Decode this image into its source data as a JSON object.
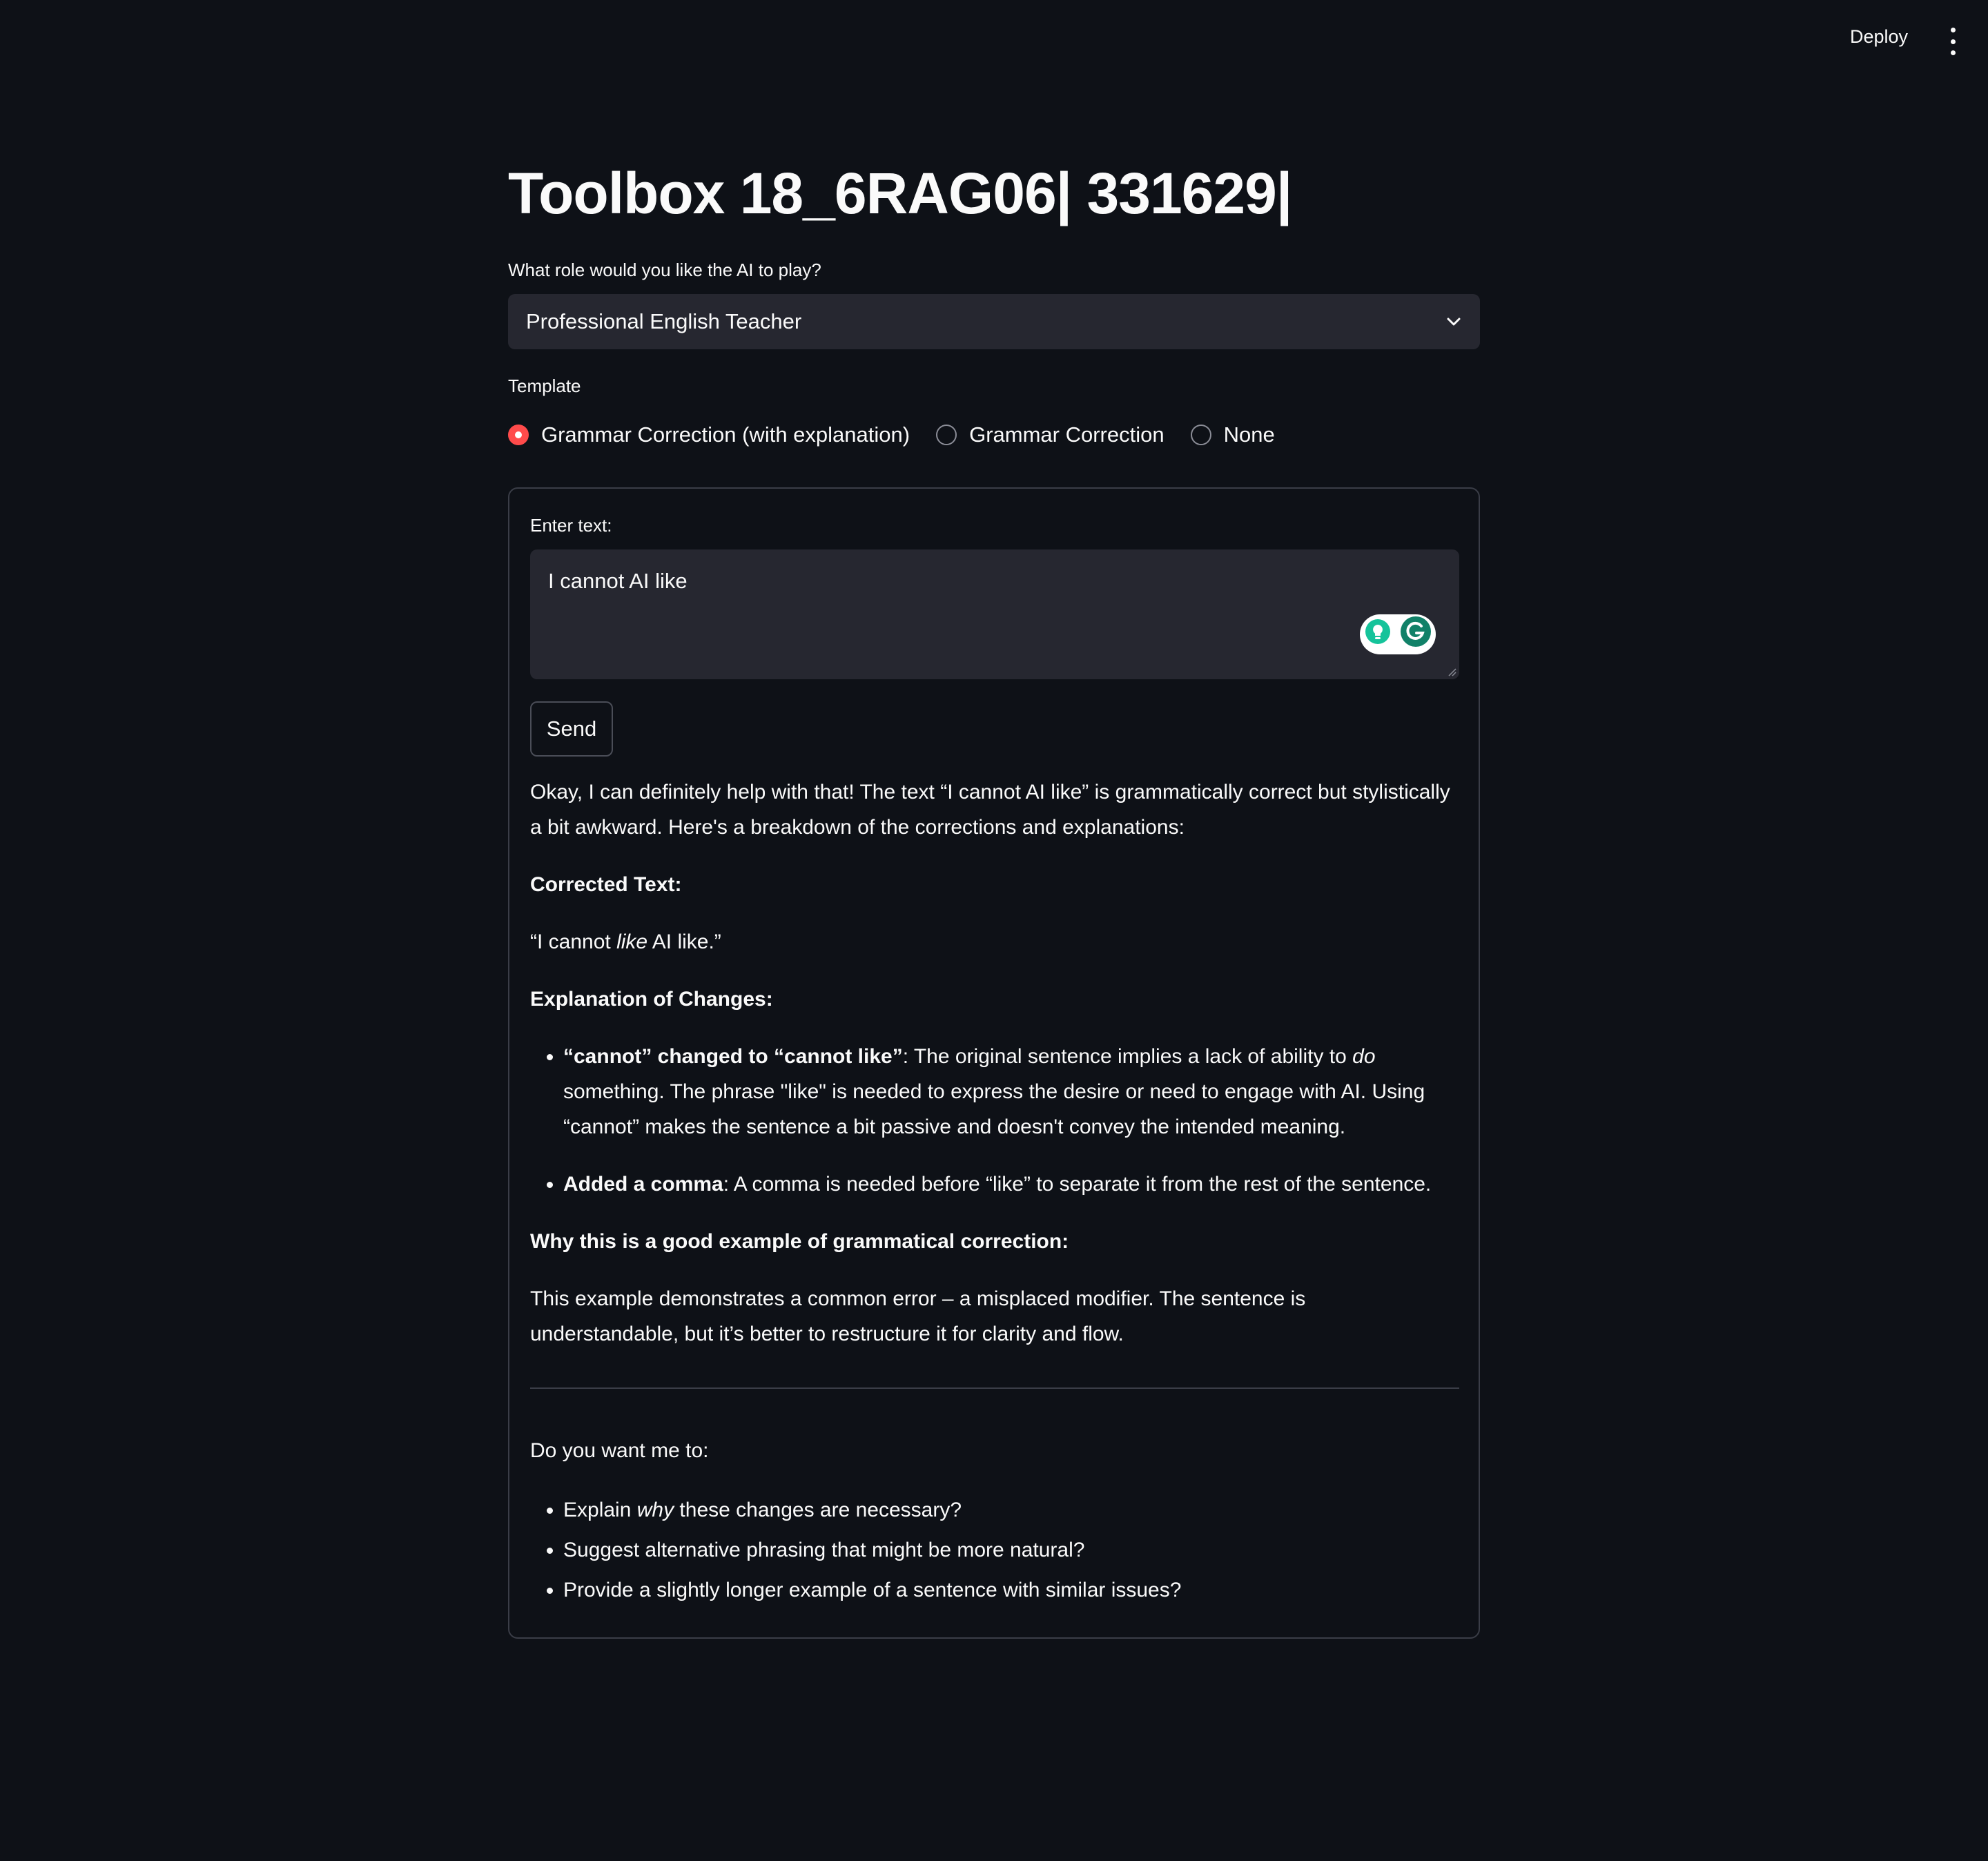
{
  "header": {
    "deploy_label": "Deploy",
    "menu_icon": "more-vertical-icon"
  },
  "page": {
    "title": "Toolbox 18_6RAG06| 331629|"
  },
  "role_select": {
    "label": "What role would you like the AI to play?",
    "value": "Professional English Teacher",
    "icon": "chevron-down-icon"
  },
  "template": {
    "label": "Template",
    "options": [
      {
        "label": "Grammar Correction (with explanation)",
        "checked": true
      },
      {
        "label": "Grammar Correction",
        "checked": false
      },
      {
        "label": "None",
        "checked": false
      }
    ]
  },
  "input": {
    "label": "Enter text:",
    "value": "I cannot AI like"
  },
  "send_label": "Send",
  "response": {
    "intro": "Okay, I can definitely help with that! The text “I cannot AI like” is grammatically correct but stylistically a bit awkward. Here's a breakdown of the corrections and explanations:",
    "corrected_heading": "Corrected Text:",
    "corrected_pre": "“I cannot ",
    "corrected_em": "like",
    "corrected_post": " AI like.”",
    "explanation_heading": "Explanation of Changes:",
    "bullet1_bold": "“cannot” changed to “cannot like”",
    "bullet1_text_a": ": The original sentence implies a lack of ability to ",
    "bullet1_em": "do",
    "bullet1_text_b": " something. The phrase \"like\" is needed to express the desire or need to engage with AI. Using “cannot” makes the sentence a bit passive and doesn't convey the intended meaning.",
    "bullet2_bold": "Added a comma",
    "bullet2_text": ": A comma is needed before “like” to separate it from the rest of the sentence.",
    "why_heading": "Why this is a good example of grammatical correction:",
    "why_text": "This example demonstrates a common error – a misplaced modifier. The sentence is understandable, but it’s better to restructure it for clarity and flow.",
    "followup_intro": "Do you want me to:",
    "followup1_pre": "Explain ",
    "followup1_em": "why",
    "followup1_post": " these changes are necessary?",
    "followup2": "Suggest alternative phrasing that might be more natural?",
    "followup3": "Provide a slightly longer example of a sentence with similar issues?"
  },
  "colors": {
    "background": "#0e1117",
    "input_bg": "#262730",
    "accent": "#ff4b4b",
    "grammarly_green": "#15c39a"
  }
}
